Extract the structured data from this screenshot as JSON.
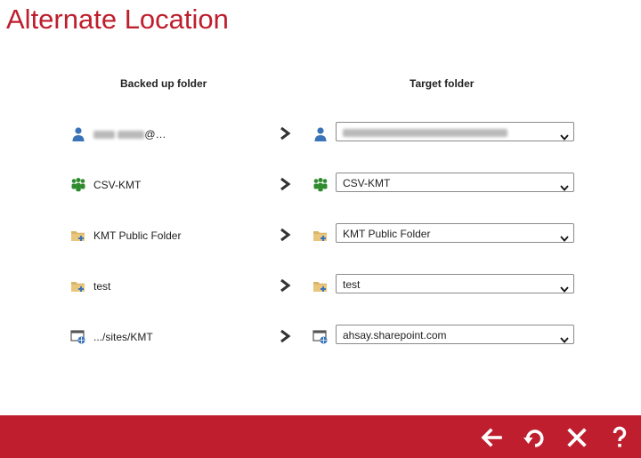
{
  "page": {
    "title": "Alternate Location"
  },
  "columns": {
    "source_header": "Backed up folder",
    "target_header": "Target folder"
  },
  "rows": [
    {
      "source_icon": "user-icon",
      "source_label": "@…",
      "target_icon": "user-icon",
      "target_value": ""
    },
    {
      "source_icon": "group-icon",
      "source_label": "CSV-KMT",
      "target_icon": "group-icon",
      "target_value": "CSV-KMT"
    },
    {
      "source_icon": "public-folder-icon",
      "source_label": "KMT Public Folder",
      "target_icon": "public-folder-icon",
      "target_value": "KMT Public Folder"
    },
    {
      "source_icon": "public-folder-icon",
      "source_label": "test",
      "target_icon": "public-folder-icon",
      "target_value": "test"
    },
    {
      "source_icon": "sharepoint-site-icon",
      "source_label": ".../sites/KMT",
      "target_icon": "sharepoint-site-icon",
      "target_value": "ahsay.sharepoint.com"
    }
  ],
  "footer": {
    "buttons": [
      "back-arrow-icon",
      "restore-icon",
      "close-icon",
      "help-icon"
    ]
  },
  "colors": {
    "brand_red": "#be1e2d",
    "icon_blue": "#3a73b8",
    "icon_green": "#2e8b2e",
    "folder_tan": "#d9b56a"
  }
}
